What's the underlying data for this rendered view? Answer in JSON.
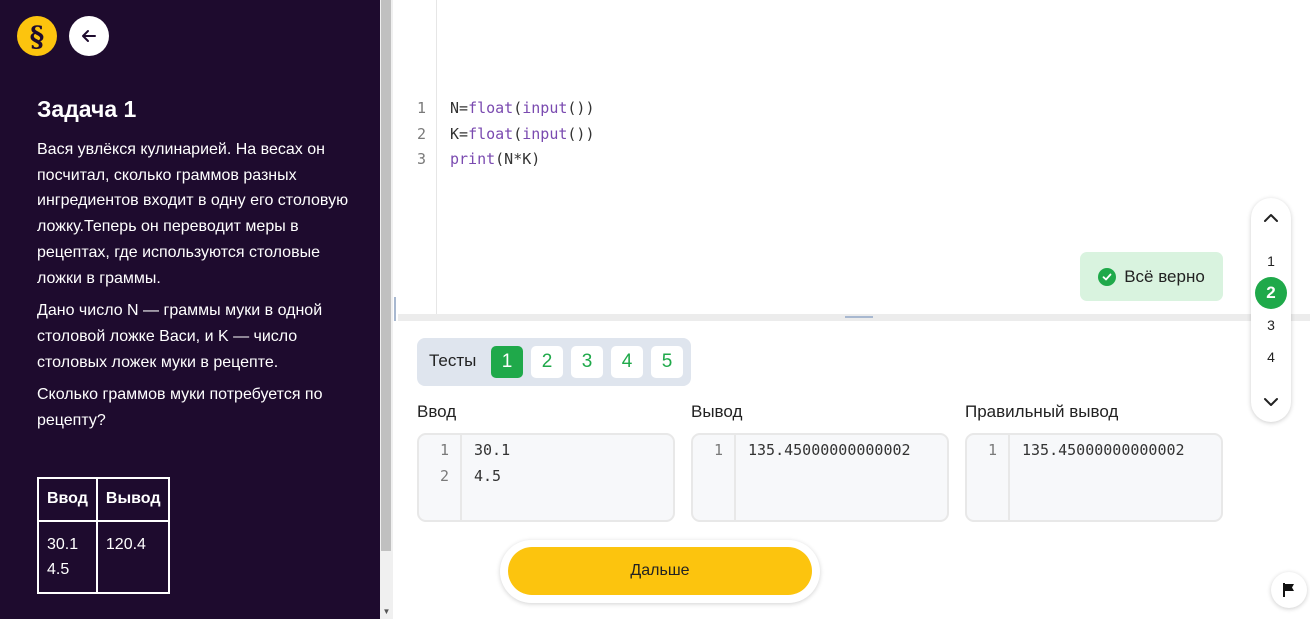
{
  "sidebar": {
    "logo_glyph": "§",
    "task_title": "Задача 1",
    "paragraphs": [
      "Вася увлёкся кулинарией. На весах он посчитал, сколько граммов разных ингредиентов входит в одну его столовую ложку.Теперь он переводит меры в рецептах, где используются столовые ложки в граммы.",
      "Дано число N — граммы муки в одной столовой ложке Васи, и K — число столовых ложек муки в рецепте.",
      "Сколько граммов муки потребуется по рецепту?"
    ],
    "example": {
      "headers": [
        "Ввод",
        "Вывод"
      ],
      "input_lines": [
        "30.1",
        "4.5"
      ],
      "output_lines": [
        "120.4"
      ]
    }
  },
  "editor": {
    "lines": [
      {
        "n": "1",
        "tokens": [
          [
            "",
            "N="
          ],
          [
            "kw",
            "float"
          ],
          [
            "",
            "("
          ],
          [
            "kw",
            "input"
          ],
          [
            "",
            "())"
          ]
        ]
      },
      {
        "n": "2",
        "tokens": [
          [
            "",
            "K="
          ],
          [
            "kw",
            "float"
          ],
          [
            "",
            "("
          ],
          [
            "kw",
            "input"
          ],
          [
            "",
            "())"
          ]
        ]
      },
      {
        "n": "3",
        "tokens": [
          [
            "kw",
            "print"
          ],
          [
            "",
            "(N*K)"
          ]
        ]
      }
    ],
    "status_text": "Всё верно"
  },
  "tests": {
    "label": "Тесты",
    "items": [
      "1",
      "2",
      "3",
      "4",
      "5"
    ],
    "active_index": 0
  },
  "io": {
    "input": {
      "label": "Ввод",
      "lines": [
        "30.1",
        "4.5"
      ]
    },
    "output": {
      "label": "Вывод",
      "lines": [
        "135.45000000000002"
      ]
    },
    "expected": {
      "label": "Правильный вывод",
      "lines": [
        "135.45000000000002"
      ]
    }
  },
  "next_button": "Дальше",
  "task_nav": {
    "items": [
      "1",
      "2",
      "3",
      "4"
    ],
    "active_index": 1
  },
  "colors": {
    "sidebar_bg": "#1e0b2e",
    "accent_yellow": "#fcc40e",
    "success_green": "#1fa94a",
    "success_bg": "#d9f3df",
    "keyword": "#7a4ab0"
  },
  "icons": {
    "back": "arrow-left-icon",
    "status": "check-circle-icon",
    "nav_up": "chevron-up-icon",
    "nav_down": "chevron-down-icon",
    "flag": "flag-icon"
  }
}
